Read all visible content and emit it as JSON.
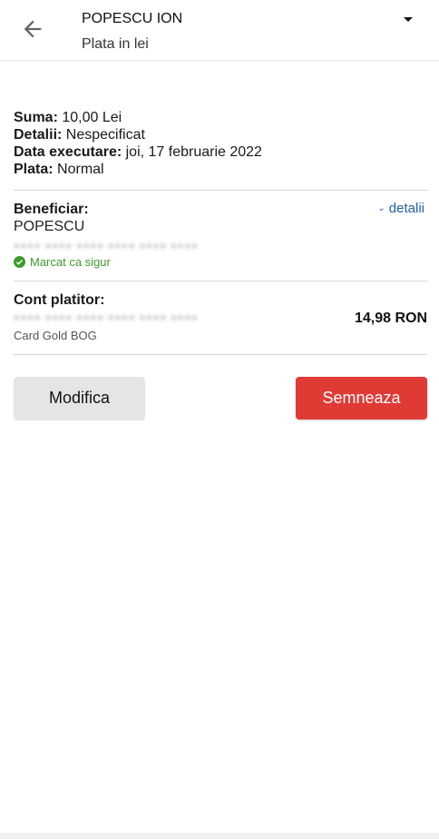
{
  "header": {
    "title": "POPESCU ION",
    "subtitle": "Plata in lei",
    "back_icon": "arrow-left-icon",
    "menu_icon": "caret-down-icon"
  },
  "summary": {
    "amount_label": "Suma:",
    "amount_value": "10,00 Lei",
    "details_label": "Detalii:",
    "details_value": "Nespecificat",
    "date_label": "Data executare:",
    "date_value": "joi, 17 februarie 2022",
    "payment_label": "Plata:",
    "payment_value": "Normal"
  },
  "beneficiary": {
    "label": "Beneficiar:",
    "name": "POPESCU",
    "details_link": "detalii",
    "safe_label": "Marcat ca sigur",
    "safe_color": "#3e9a2c"
  },
  "payer": {
    "label": "Cont platitor:",
    "balance": "14,98 RON",
    "card_name": "Card Gold BOG"
  },
  "actions": {
    "modify_label": "Modifica",
    "sign_label": "Semneaza",
    "sign_color": "#e03a35"
  }
}
